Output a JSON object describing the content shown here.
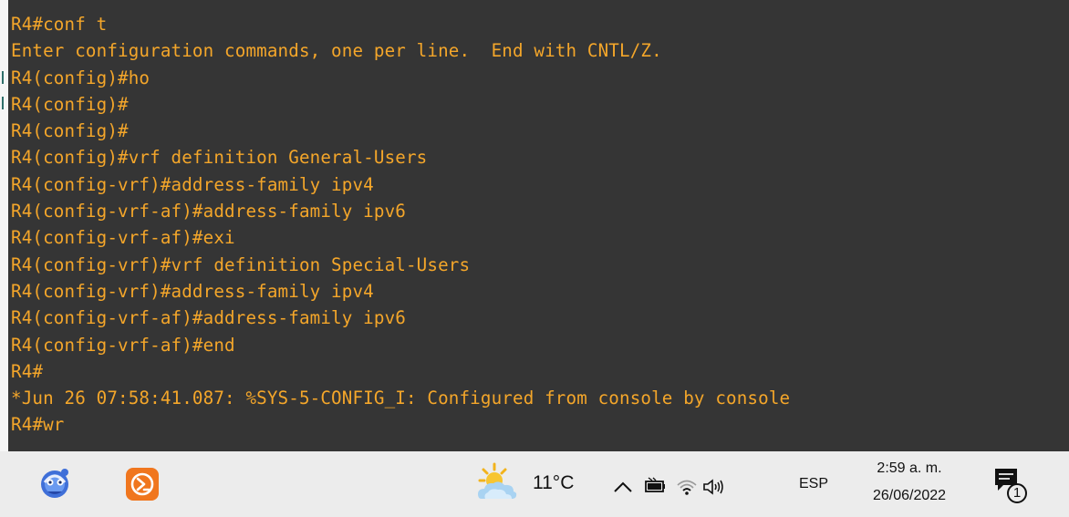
{
  "terminal": {
    "lines": [
      "R4#conf t",
      "Enter configuration commands, one per line.  End with CNTL/Z.",
      "R4(config)#ho",
      "R4(config)#",
      "R4(config)#",
      "R4(config)#vrf definition General-Users",
      "R4(config-vrf)#address-family ipv4",
      "R4(config-vrf-af)#address-family ipv6",
      "R4(config-vrf-af)#exi",
      "R4(config-vrf)#vrf definition Special-Users",
      "R4(config-vrf)#address-family ipv4",
      "R4(config-vrf-af)#address-family ipv6",
      "R4(config-vrf-af)#end",
      "R4#",
      "*Jun 26 07:58:41.087: %SYS-5-CONFIG_I: Configured from console by console",
      "R4#wr"
    ],
    "text_color": "#f4a62a",
    "background": "#353535"
  },
  "taskbar": {
    "apps": [
      {
        "icon": "packet-tracer-icon"
      },
      {
        "icon": "terminal-app-icon",
        "accent": "#f0761e"
      }
    ],
    "weather": {
      "temperature": "11°C",
      "icon": "partly-cloudy-icon"
    },
    "tray": {
      "icons": [
        "chevron-up-icon",
        "battery-icon",
        "wifi-icon",
        "volume-icon"
      ],
      "language": "ESP"
    },
    "clock": {
      "time": "2:59 a. m.",
      "date": "26/06/2022"
    },
    "notifications": {
      "icon": "notification-icon",
      "count": "1"
    }
  }
}
